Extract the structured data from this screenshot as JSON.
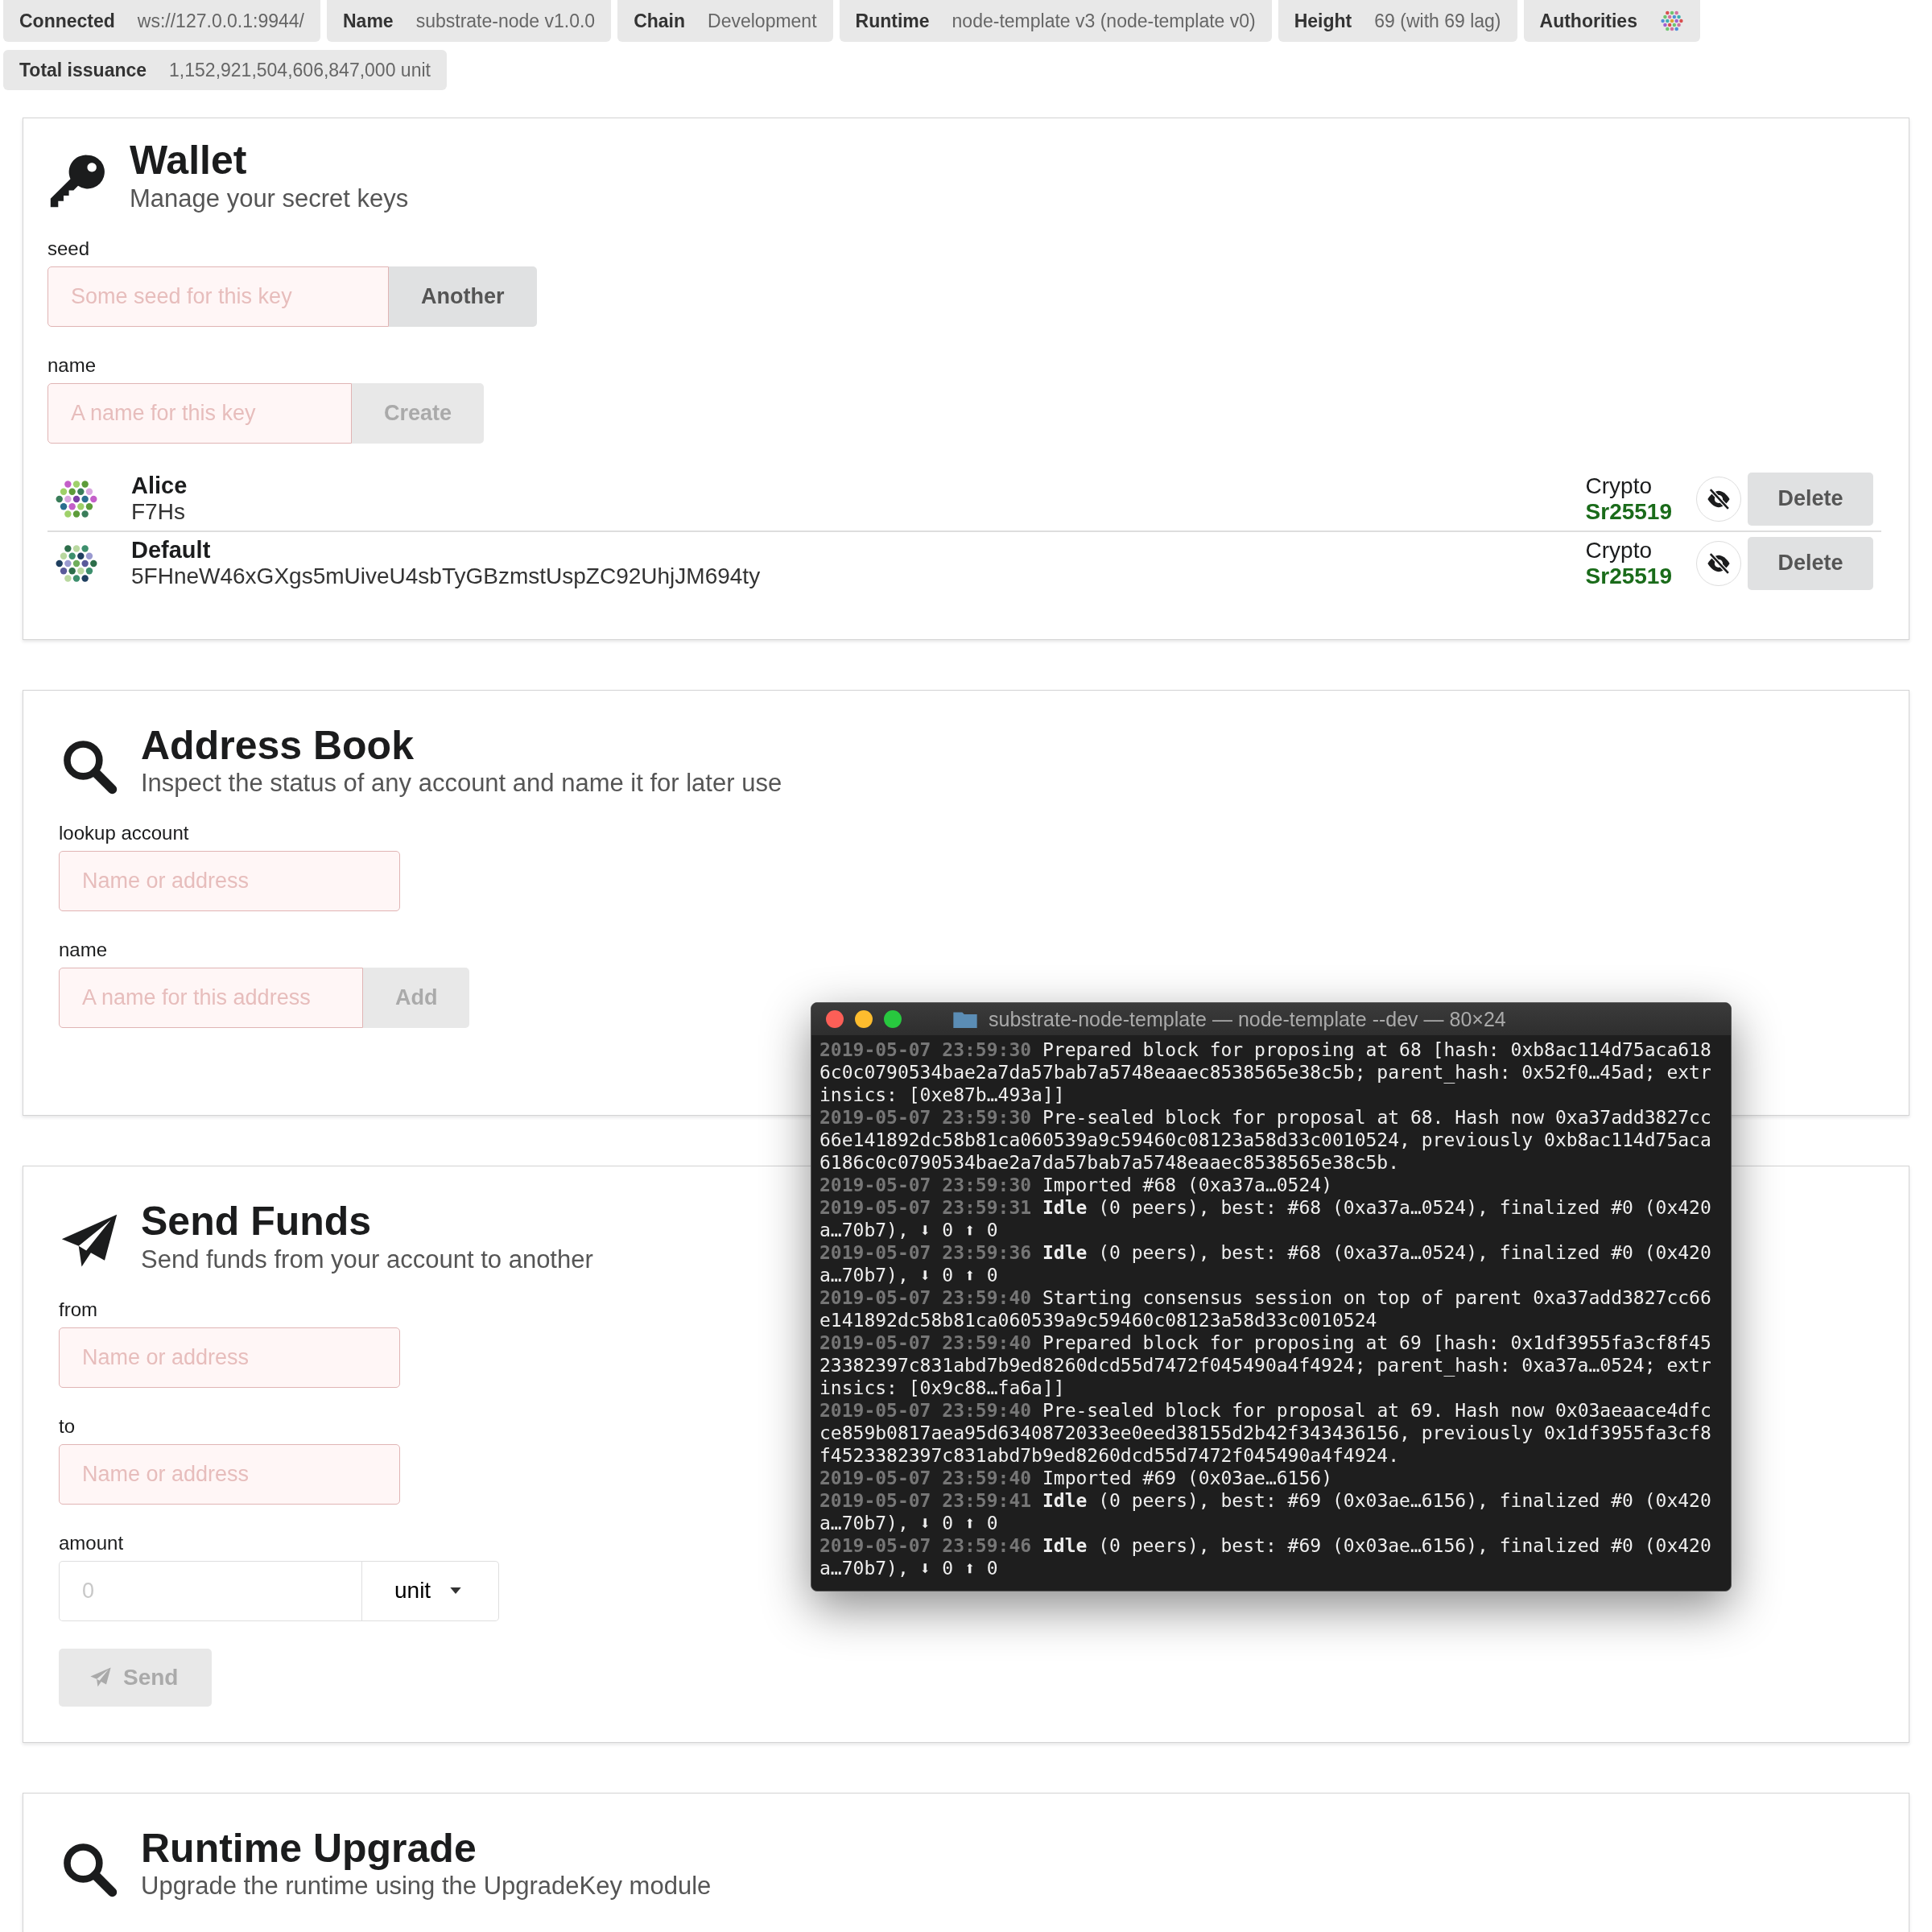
{
  "status_chips": [
    {
      "kind": "text",
      "label": "Connected",
      "value": "ws://127.0.0.1:9944/"
    },
    {
      "kind": "text",
      "label": "Name",
      "value": "substrate-node v1.0.0"
    },
    {
      "kind": "text",
      "label": "Chain",
      "value": "Development"
    },
    {
      "kind": "text",
      "label": "Runtime",
      "value": "node-template v3 (node-template v0)"
    },
    {
      "kind": "text",
      "label": "Height",
      "value": "69 (with 69 lag)"
    },
    {
      "kind": "identicon",
      "label": "Authorities"
    },
    {
      "kind": "text",
      "label": "Total issuance",
      "value": "1,152,921,504,606,847,000 unit"
    }
  ],
  "sections": [
    {
      "kind": "wallet",
      "title": "Wallet",
      "subtitle": "Manage your secret keys",
      "fields": [
        {
          "kind": "input_button",
          "label": "seed",
          "placeholder": "Some seed for this key",
          "error": true,
          "button": "Another",
          "disabled": false
        },
        {
          "kind": "input_button",
          "label": "name",
          "placeholder": "A name for this key",
          "error": true,
          "button": "Create",
          "disabled": true
        }
      ],
      "keys": [
        {
          "name": "Alice",
          "address": "F7Hs",
          "crypto_label": "Crypto",
          "crypto_type": "Sr25519",
          "button": "Delete"
        },
        {
          "name": "Default",
          "address": "5FHneW46xGXgs5mUiveU4sbTyGBzmstUspZC92UhjJM694ty",
          "crypto_label": "Crypto",
          "crypto_type": "Sr25519",
          "button": "Delete"
        }
      ]
    },
    {
      "kind": "address_book",
      "title": "Address Book",
      "subtitle": "Inspect the status of any account and name it for later use",
      "fields": [
        {
          "kind": "input",
          "label": "lookup account",
          "placeholder": "Name or address",
          "error": true
        },
        {
          "kind": "input_button",
          "label": "name",
          "placeholder": "A name for this address",
          "error": true,
          "button": "Add",
          "disabled": true
        }
      ]
    },
    {
      "kind": "send_funds",
      "title": "Send Funds",
      "subtitle": "Send funds from your account to another",
      "fields": [
        {
          "kind": "input",
          "label": "from",
          "placeholder": "Name or address",
          "error": true
        },
        {
          "kind": "input",
          "label": "to",
          "placeholder": "Name or address",
          "error": true
        },
        {
          "kind": "amount",
          "label": "amount",
          "placeholder": "0",
          "error": false,
          "unit": "unit"
        },
        {
          "kind": "send",
          "button": "Send",
          "disabled": true
        }
      ]
    },
    {
      "kind": "runtime_upgrade",
      "title": "Runtime Upgrade",
      "subtitle": "Upgrade the runtime using the UpgradeKey module"
    }
  ],
  "terminal": {
    "title": "substrate-node-template — node-template --dev — 80×24",
    "lines": [
      {
        "time": "2019-05-07 23:59:30",
        "message": "Prepared block for proposing at 68 [hash: 0xb8ac114d75aca6186c0c0790534bae2a7da57bab7a5748eaaec8538565e38c5b; parent_hash: 0x52f0…45ad; extrinsics: [0xe87b…493a]]"
      },
      {
        "time": "2019-05-07 23:59:30",
        "message": "Pre-sealed block for proposal at 68. Hash now 0xa37add3827cc66e141892dc58b81ca060539a9c59460c08123a58d33c0010524, previously 0xb8ac114d75aca6186c0c0790534bae2a7da57bab7a5748eaaec8538565e38c5b."
      },
      {
        "time": "2019-05-07 23:59:30",
        "message": "Imported #68 (0xa37a…0524)"
      },
      {
        "time": "2019-05-07 23:59:31",
        "message": "**Idle** (0 peers), best: #68 (0xa37a…0524), finalized #0 (0x420a…70b7), ⬇ 0 ⬆ 0"
      },
      {
        "time": "2019-05-07 23:59:36",
        "message": "**Idle** (0 peers), best: #68 (0xa37a…0524), finalized #0 (0x420a…70b7), ⬇ 0 ⬆ 0"
      },
      {
        "time": "2019-05-07 23:59:40",
        "message": "Starting consensus session on top of parent 0xa37add3827cc66e141892dc58b81ca060539a9c59460c08123a58d33c0010524"
      },
      {
        "time": "2019-05-07 23:59:40",
        "message": "Prepared block for proposing at 69 [hash: 0x1df3955fa3cf8f4523382397c831abd7b9ed8260dcd55d7472f045490a4f4924; parent_hash: 0xa37a…0524; extrinsics: [0x9c88…fa6a]]"
      },
      {
        "time": "2019-05-07 23:59:40",
        "message": "Pre-sealed block for proposal at 69. Hash now 0x03aeaace4dfcce859b0817aea95d6340872033ee0eed38155d2b42f343436156, previously 0x1df3955fa3cf8f4523382397c831abd7b9ed8260dcd55d7472f045490a4f4924."
      },
      {
        "time": "2019-05-07 23:59:40",
        "message": "Imported #69 (0x03ae…6156)"
      },
      {
        "time": "2019-05-07 23:59:41",
        "message": "**Idle** (0 peers), best: #69 (0x03ae…6156), finalized #0 (0x420a…70b7), ⬇ 0 ⬆ 0"
      },
      {
        "time": "2019-05-07 23:59:46",
        "message": "**Idle** (0 peers), best: #69 (0x03ae…6156), finalized #0 (0x420a…70b7), ⬇ 0 ⬆ 0"
      }
    ]
  }
}
